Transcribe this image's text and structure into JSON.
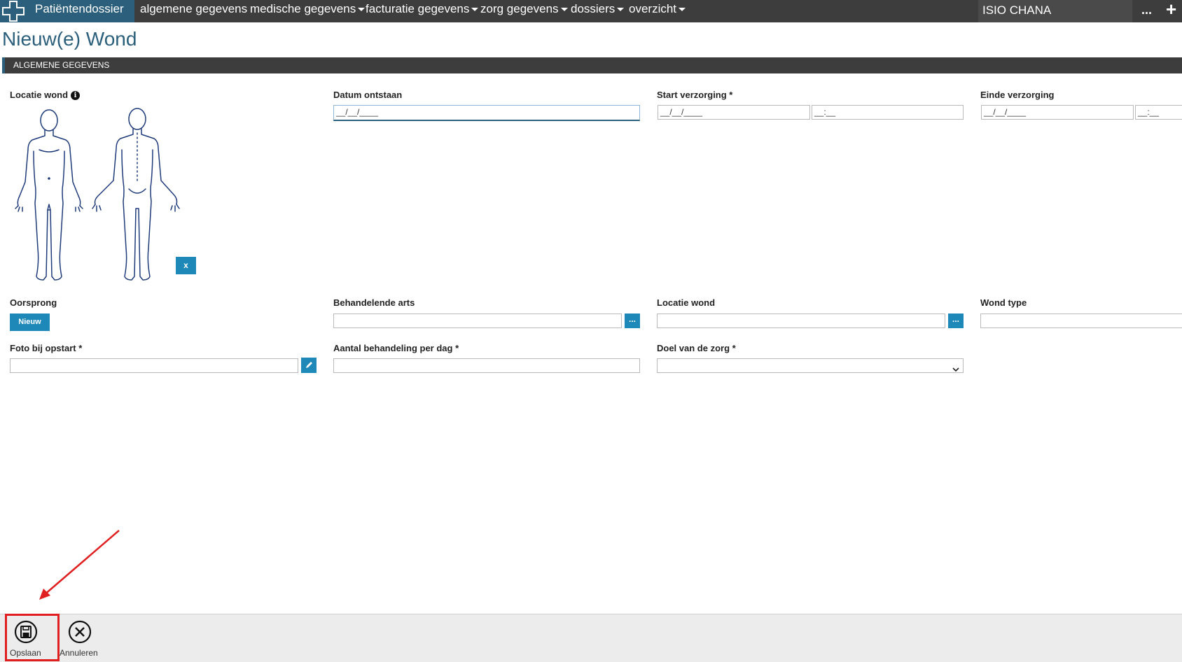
{
  "topbar": {
    "brand": "Patiëntendossier",
    "nav": [
      {
        "label": "algemene gegevens",
        "caret": false
      },
      {
        "label": "medische gegevens",
        "caret": true
      },
      {
        "label": "facturatie gegevens",
        "caret": true
      },
      {
        "label": "zorg gegevens",
        "caret": true
      },
      {
        "label": "dossiers",
        "caret": true
      },
      {
        "label": "overzicht",
        "caret": true
      }
    ],
    "user": "ISIO CHANA",
    "more": "...",
    "add": "+"
  },
  "page": {
    "title": "Nieuw(e) Wond",
    "section": "ALGEMENE GEGEVENS"
  },
  "form": {
    "locatie_wond_label": "Locatie wond",
    "locatie_wond_info": "i",
    "clear_button": "x",
    "datum_ontstaan_label": "Datum ontstaan",
    "datum_ontstaan_value": "__/__/____",
    "start_verzorging_label": "Start verzorging *",
    "start_date_value": "__/__/____",
    "start_time_value": "__:__",
    "einde_verzorging_label": "Einde verzorging",
    "einde_date_value": "__/__/____",
    "einde_time_value": "__:__",
    "oorsprong_label": "Oorsprong",
    "nieuw_button": "Nieuw",
    "behandelende_arts_label": "Behandelende arts",
    "lookup_button": "...",
    "locatie_wond2_label": "Locatie wond",
    "wond_type_label": "Wond type",
    "foto_label": "Foto bij opstart *",
    "aantal_label": "Aantal behandeling per dag *",
    "doel_label": "Doel van de zorg *"
  },
  "footer": {
    "save": "Opslaan",
    "cancel": "Annuleren"
  },
  "colors": {
    "brand_blue": "#2b5f7c",
    "button_blue": "#1e88b8",
    "topbar": "#3d3d3d",
    "highlight_red": "#e02020"
  }
}
